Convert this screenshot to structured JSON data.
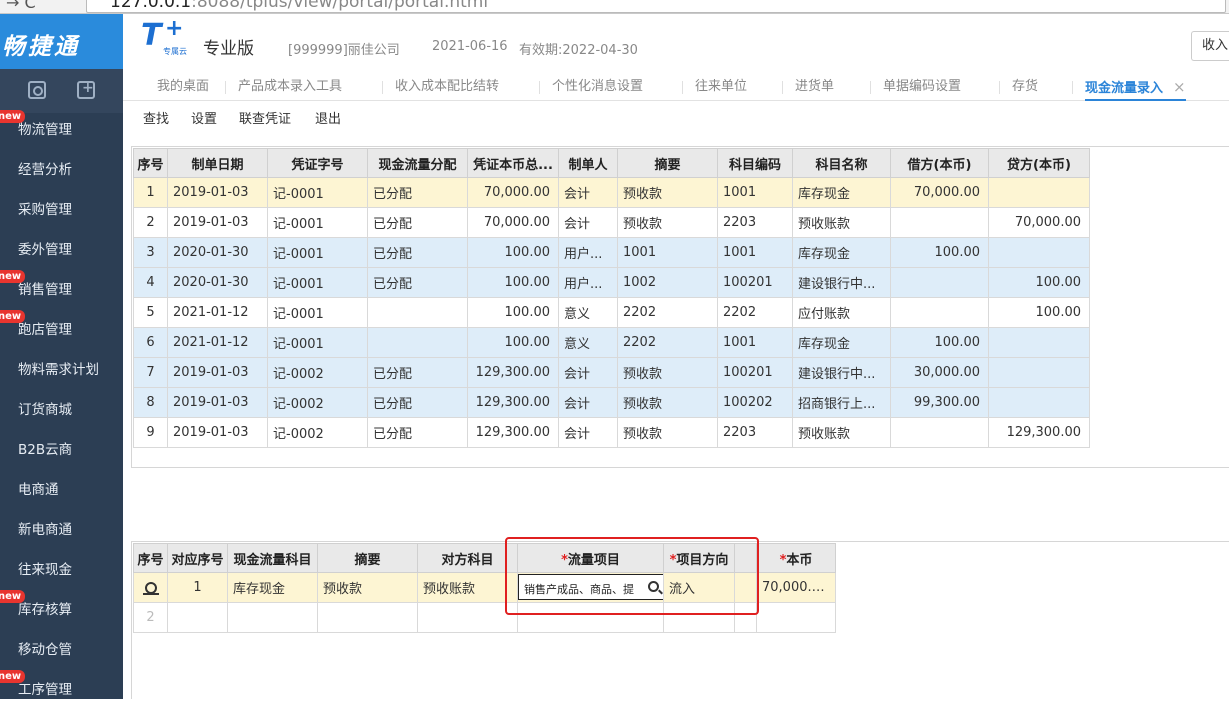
{
  "browser": {
    "url_host": "127.0.0.1",
    "url_rest": ":8088/tplus/view/portal/portal.html"
  },
  "sidebar": {
    "brand": "畅捷通",
    "items": [
      {
        "label": "物流管理",
        "badge": "new"
      },
      {
        "label": "经营分析",
        "badge": ""
      },
      {
        "label": "采购管理",
        "badge": ""
      },
      {
        "label": "委外管理",
        "badge": ""
      },
      {
        "label": "销售管理",
        "badge": "new"
      },
      {
        "label": "跑店管理",
        "badge": "new"
      },
      {
        "label": "物料需求计划",
        "badge": ""
      },
      {
        "label": "订货商城",
        "badge": ""
      },
      {
        "label": "B2B云商",
        "badge": ""
      },
      {
        "label": "电商通",
        "badge": ""
      },
      {
        "label": "新电商通",
        "badge": ""
      },
      {
        "label": "往来现金",
        "badge": ""
      },
      {
        "label": "库存核算",
        "badge": "new"
      },
      {
        "label": "移动仓管",
        "badge": ""
      },
      {
        "label": "工序管理",
        "badge": "new"
      }
    ]
  },
  "header": {
    "logo_text": "T",
    "logo_sub": "专属云",
    "edition": "专业版",
    "company": "[999999]丽佳公司",
    "date": "2021-06-16",
    "valid": "有效期:2022-04-30",
    "right_button": "收入"
  },
  "tabs": [
    {
      "label": "我的桌面"
    },
    {
      "label": "产品成本录入工具"
    },
    {
      "label": "收入成本配比结转"
    },
    {
      "label": "个性化消息设置"
    },
    {
      "label": "往来单位"
    },
    {
      "label": "进货单"
    },
    {
      "label": "单据编码设置"
    },
    {
      "label": "存货"
    },
    {
      "label": "现金流量录入",
      "active": true
    }
  ],
  "toolbar": {
    "find": "查找",
    "settings": "设置",
    "link_voucher": "联查凭证",
    "exit": "退出"
  },
  "grid1": {
    "headers": [
      "序号",
      "制单日期",
      "凭证字号",
      "现金流量分配",
      "凭证本币总...",
      "制单人",
      "摘要",
      "科目编码",
      "科目名称",
      "借方(本币)",
      "贷方(本币)"
    ],
    "rows": [
      [
        "1",
        "2019-01-03",
        "记-0001",
        "已分配",
        "70,000.00",
        "会计",
        "预收款",
        "1001",
        "库存现金",
        "70,000.00",
        ""
      ],
      [
        "2",
        "2019-01-03",
        "记-0001",
        "已分配",
        "70,000.00",
        "会计",
        "预收款",
        "2203",
        "预收账款",
        "",
        "70,000.00"
      ],
      [
        "3",
        "2020-01-30",
        "记-0001",
        "已分配",
        "100.00",
        "用户...",
        "1001",
        "1001",
        "库存现金",
        "100.00",
        ""
      ],
      [
        "4",
        "2020-01-30",
        "记-0001",
        "已分配",
        "100.00",
        "用户...",
        "1002",
        "100201",
        "建设银行中...",
        "",
        "100.00"
      ],
      [
        "5",
        "2021-01-12",
        "记-0001",
        "",
        "100.00",
        "意义",
        "2202",
        "2202",
        "应付账款",
        "",
        "100.00"
      ],
      [
        "6",
        "2021-01-12",
        "记-0001",
        "",
        "100.00",
        "意义",
        "2202",
        "1001",
        "库存现金",
        "100.00",
        ""
      ],
      [
        "7",
        "2019-01-03",
        "记-0002",
        "已分配",
        "129,300.00",
        "会计",
        "预收款",
        "100201",
        "建设银行中...",
        "30,000.00",
        ""
      ],
      [
        "8",
        "2019-01-03",
        "记-0002",
        "已分配",
        "129,300.00",
        "会计",
        "预收款",
        "100202",
        "招商银行上...",
        "99,300.00",
        ""
      ],
      [
        "9",
        "2019-01-03",
        "记-0002",
        "已分配",
        "129,300.00",
        "会计",
        "预收款",
        "2203",
        "预收账款",
        "",
        "129,300.00"
      ]
    ]
  },
  "grid2": {
    "headers": [
      "序号",
      "对应序号",
      "现金流量科目",
      "摘要",
      "对方科目",
      "流量项目",
      "项目方向",
      "",
      "本币"
    ],
    "required_mark": "*",
    "rows": [
      {
        "seq": "",
        "ref": "1",
        "cash_account": "库存现金",
        "summary": "预收款",
        "counter": "预收账款",
        "flow_item": "销售产成品、商品、提",
        "direction": "流入",
        "amount": "70,000.00"
      },
      {
        "seq": "2",
        "ref": "",
        "cash_account": "",
        "summary": "",
        "counter": "",
        "flow_item": "",
        "direction": "",
        "amount": ""
      }
    ]
  },
  "colors": {
    "accent": "#2b84d8",
    "sidebar": "#2c3e54",
    "brand": "#2a8bdc",
    "highlight": "#e02020"
  }
}
